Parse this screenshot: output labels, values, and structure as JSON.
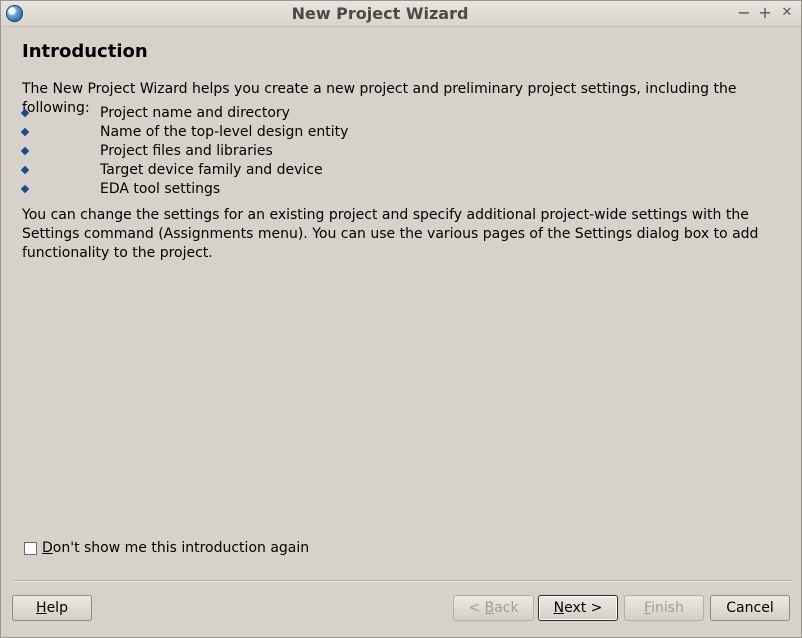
{
  "window": {
    "title": "New Project Wizard",
    "controls": {
      "minimize": "−",
      "maximize": "+",
      "close": "✕"
    }
  },
  "page": {
    "heading": "Introduction",
    "intro": "The New Project Wizard helps you create a new project and preliminary project settings, including the following:",
    "bullets": [
      "Project name and directory",
      "Name of the top-level design entity",
      "Project files and libraries",
      "Target device family and device",
      "EDA tool settings"
    ],
    "settings_note": "You can change the settings for an existing project and specify additional project-wide settings with the Settings command (Assignments menu). You can use the various pages of the Settings dialog box to add functionality to the project."
  },
  "checkbox": {
    "label_mnemonic": "D",
    "label_rest": "on't show me this introduction again",
    "checked": false
  },
  "buttons": {
    "help": {
      "mnemonic": "H",
      "rest": "elp"
    },
    "back": {
      "prefix": "< ",
      "mnemonic": "B",
      "rest": "ack"
    },
    "next": {
      "mnemonic": "N",
      "rest": "ext >"
    },
    "finish": {
      "mnemonic": "F",
      "rest": "inish"
    },
    "cancel": "Cancel"
  },
  "colors": {
    "background": "#d6d2ca",
    "bullet": "#1a4a8c"
  }
}
